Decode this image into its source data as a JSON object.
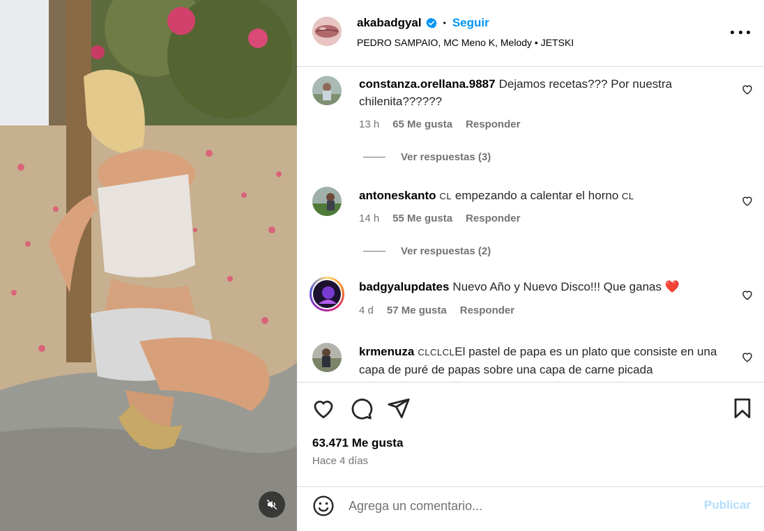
{
  "post": {
    "author": "akabadgyal",
    "verified_icon": "verified-badge-icon",
    "follow_label": "Seguir",
    "separator": "•",
    "audio": "PEDRO SAMPAIO, MC Meno K, Melody • JETSKI",
    "likes": "63.471 Me gusta",
    "time_ago": "Hace 4 días"
  },
  "comments": [
    {
      "username": "constanza.orellana.9887",
      "text": "Dejamos recetas??? Por nuestra chilenita??????",
      "time": "13 h",
      "likes": "65 Me gusta",
      "reply_label": "Responder",
      "view_replies": "Ver respuestas (3)"
    },
    {
      "username": "antoneskanto",
      "text_prefix": "CL",
      "text": "empezando a calentar el horno",
      "text_suffix": "CL",
      "time": "14 h",
      "likes": "55 Me gusta",
      "reply_label": "Responder",
      "view_replies": "Ver respuestas (2)"
    },
    {
      "username": "badgyalupdates",
      "text": "Nuevo Año y Nuevo Disco!!! Que ganas",
      "emoji": "❤️",
      "time": "4 d",
      "likes": "57 Me gusta",
      "reply_label": "Responder"
    },
    {
      "username": "krmenuza",
      "text_prefix": "CLCLCL",
      "text": "El pastel de papa es un plato que consiste en una capa de puré de papas sobre una capa de carne picada"
    }
  ],
  "add_comment": {
    "placeholder": "Agrega un comentario...",
    "publish_label": "Publicar"
  },
  "colors": {
    "accent": "#0095f6",
    "muted": "#737373",
    "divider": "#dbdbdb",
    "publish_disabled": "#b2dffc",
    "story_ring": [
      "#feda75",
      "#fa7e1e",
      "#d62976",
      "#962fbf"
    ]
  }
}
